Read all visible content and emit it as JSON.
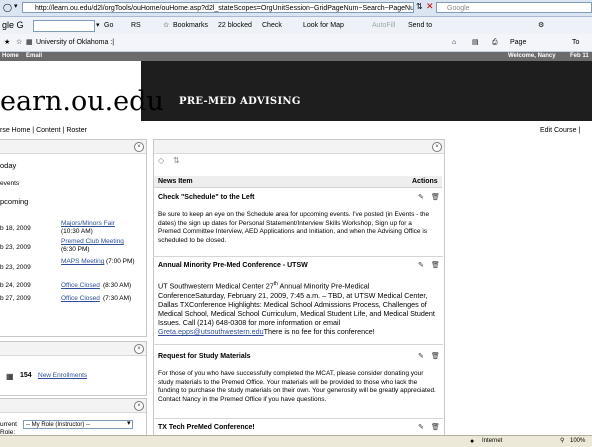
{
  "browser": {
    "url": "http://learn.ou.edu/d2l/orgTools/ouHome/ouHome.asp?d2l_stateScopes=OrgUnitSession~GridPageNum~Search~PageNum",
    "search_placeholder": "Google",
    "toolbar1": {
      "google_label": "gle G",
      "go_label": "Go",
      "rs_label": "RS",
      "bookmarks_label": "Bookmarks",
      "blocked_label": "22 blocked",
      "check_label": "Check",
      "lookformap_label": "Look for Map",
      "autofill_label": "AutoFill",
      "sendto_label": "Send to"
    },
    "tab_label": "University of Oklahoma :|",
    "toolbar2": {
      "page_label": "Page",
      "tools_label": "To"
    }
  },
  "site": {
    "topnav_home": "Home",
    "topnav_email": "Email",
    "welcome": "Welcome, Nancy",
    "welcome_date": "Feb 11",
    "name": "earn.ou.edu",
    "banner_title": "PRE-MED ADVISING",
    "crumb_course_home": "rse Home",
    "crumb_content": "Content",
    "crumb_roster": "Roster",
    "edit_course": "Edit Course |"
  },
  "left": {
    "today_label": "oday",
    "events_label": "events",
    "upcoming_label": "pcoming",
    "events": [
      {
        "date": "b 18, 2009",
        "title": "Majors/Minors Fair",
        "time": "(10:30 AM)"
      },
      {
        "date": "b 23, 2009",
        "title": "Premed Club Meeting",
        "time": "(6:30 PM)"
      },
      {
        "date": "b 23, 2009",
        "title": "MAPS Meeting",
        "time": "(7:00 PM)"
      },
      {
        "date": "b 24, 2009",
        "title": "Office Closed",
        "time": "(8:30 AM)"
      },
      {
        "date": "b 27, 2009",
        "title": "Office Closed",
        "time": "(7:30 AM)"
      }
    ],
    "enrollments_count": "154",
    "enrollments_label": "New Enrollments",
    "role_label_a": "urrent",
    "role_label_b": "Role:",
    "role_select": "-- My Role (Instructor) --"
  },
  "news": {
    "col_item": "News Item",
    "col_actions": "Actions",
    "items": [
      {
        "title": "Check \"Schedule\" to the Left",
        "body": "Be sure to keep an eye on the Schedule area for upcoming events.  I've posted (in Events - the dates) the sign up dates for Personal Statement/Interview Skills Workshop, Sign up for a Premed Committee Interview, AED Applications and Initiation, and when the Advising Office is scheduled to be closed."
      },
      {
        "title": "Annual Minority Pre-Med Conference - UTSW",
        "body_pre": "UT Southwestern Medical Center 27",
        "body_sup": "th",
        "body_mid": " Annual Minority Pre-Medical ConferenceSaturday, February 21, 2009, 7:45 a.m. – TBD, at UTSW Medical Center, Dallas TXConference Highlights: Medical School Admissions Process, Challenges of Medical School, Medical School Curriculum, Medical Student Life, and Medical Student Issues.  Call (214) 648-0308 for more information or email ",
        "body_link": "Greta.epps@utsouthwestern.edu",
        "body_post": "There is no fee for this conference!"
      },
      {
        "title": "Request for Study Materials",
        "body": "For those of you who have successfully completed the MCAT, please consider donating your study materials to the Premed Office.  Your materials will be provided to those who lack the funding to purchase the study materials on their own.  Your generosity will be greatly appreciated.  Contact Nancy in the Premed Office if you have questions."
      },
      {
        "title": "TX Tech PreMed Conference!"
      }
    ]
  },
  "status": {
    "zone": "Internet",
    "zoom": "100%"
  }
}
